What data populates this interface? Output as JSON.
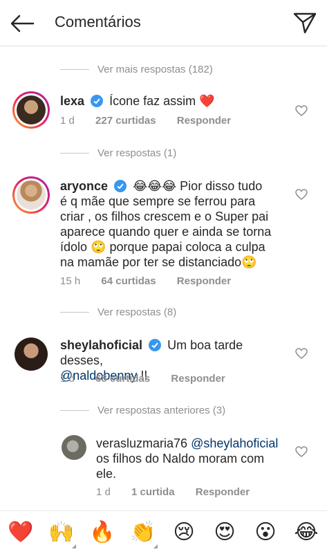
{
  "header": {
    "title": "Comentários"
  },
  "threads": [
    {
      "more_label": "Ver mais respostas (182)"
    },
    {
      "more_label": "Ver respostas (1)"
    },
    {
      "more_label": "Ver respostas (8)"
    },
    {
      "more_label": "Ver respostas anteriores (3)"
    }
  ],
  "comments": [
    {
      "username": "lexa",
      "verified": true,
      "text": "Ícone faz assim ❤️",
      "time": "1 d",
      "likes": "227 curtidas",
      "reply": "Responder"
    },
    {
      "username": "aryonce",
      "verified": true,
      "lines": [
        "😂😂😂 Pior disso tudo",
        "é q mãe que sempre se ferrou para",
        "criar , os filhos crescem e o Super pai",
        "aparece quando quer e ainda se torna",
        "ídolo 🙄 porque papai coloca a culpa",
        "na mamãe por ter se distanciado🙄"
      ],
      "time": "15 h",
      "likes": "64 curtidas",
      "reply": "Responder"
    },
    {
      "username": "sheylahoficial",
      "verified": true,
      "text": "Um boa tarde desses,",
      "mention": "@naldobenny",
      "suffix": " !!",
      "time": "1 d",
      "likes": "68 curtidas",
      "reply": "Responder"
    },
    {
      "username": "verasluzmaria76",
      "verified": false,
      "mention": "@sheylahoficial",
      "lines": [
        "os filhos do Naldo moram com",
        "ele."
      ],
      "time": "1 d",
      "likes": "1 curtida",
      "reply": "Responder"
    }
  ],
  "emoji_bar": [
    "❤️",
    "🙌",
    "🔥",
    "👏",
    "😢",
    "😍",
    "😮",
    "😂"
  ]
}
